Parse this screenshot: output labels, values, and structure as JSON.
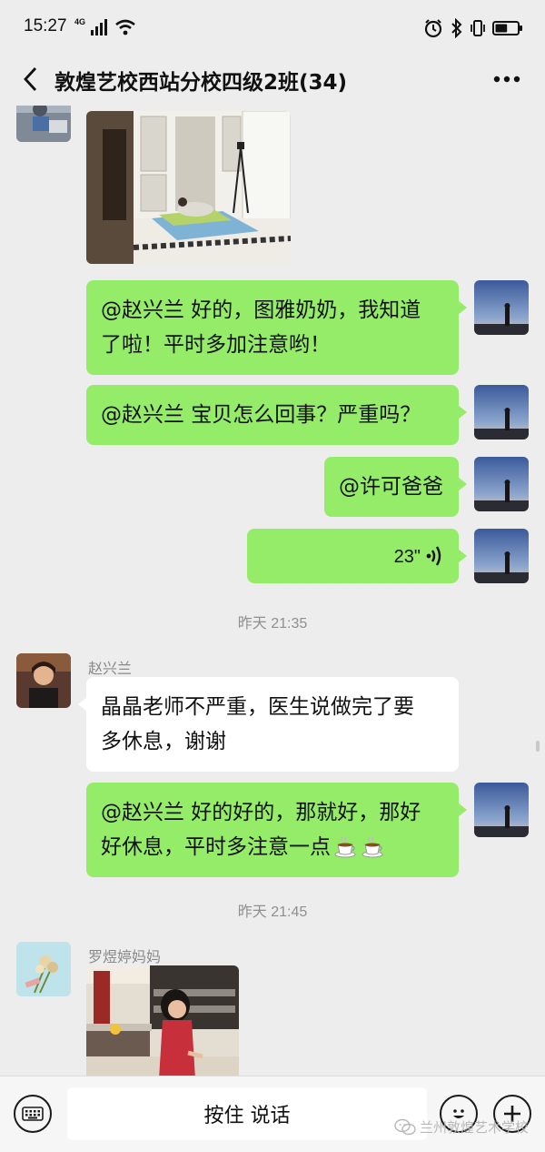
{
  "status_bar": {
    "time": "15:27",
    "network": "4G",
    "battery_level": 0.55
  },
  "header": {
    "title": "敦煌艺校西站分校四级2班(34)"
  },
  "messages": [
    {
      "type": "image",
      "side": "left",
      "description": "yoga-practice-photo"
    },
    {
      "type": "text",
      "side": "right",
      "text_line1": "@赵兴兰  好的，图雅奶奶，我知道",
      "text_line2": "了啦！平时多加注意哟！"
    },
    {
      "type": "text",
      "side": "right",
      "text": "@赵兴兰  宝贝怎么回事？严重吗？"
    },
    {
      "type": "text",
      "side": "right",
      "text": "@许可爸爸"
    },
    {
      "type": "voice",
      "side": "right",
      "duration": "23\""
    },
    {
      "type": "text",
      "side": "left",
      "sender": "赵兴兰",
      "text_line1": "晶晶老师不严重，医生说做完了要",
      "text_line2": "多休息，谢谢"
    },
    {
      "type": "text",
      "side": "right",
      "text_line1": "@赵兴兰  好的好的，那就好，那好",
      "text_line2": "好休息，平时多注意一点"
    },
    {
      "type": "image",
      "side": "left",
      "sender": "罗煜婷妈妈",
      "description": "child-practice-photo"
    }
  ],
  "timestamps": [
    "昨天 21:35",
    "昨天 21:45"
  ],
  "input_bar": {
    "hold_to_talk": "按住 说话"
  },
  "watermark": "兰州敦煌艺术学校",
  "colors": {
    "background": "#ededed",
    "own_bubble": "#95ec69",
    "other_bubble": "#ffffff"
  }
}
